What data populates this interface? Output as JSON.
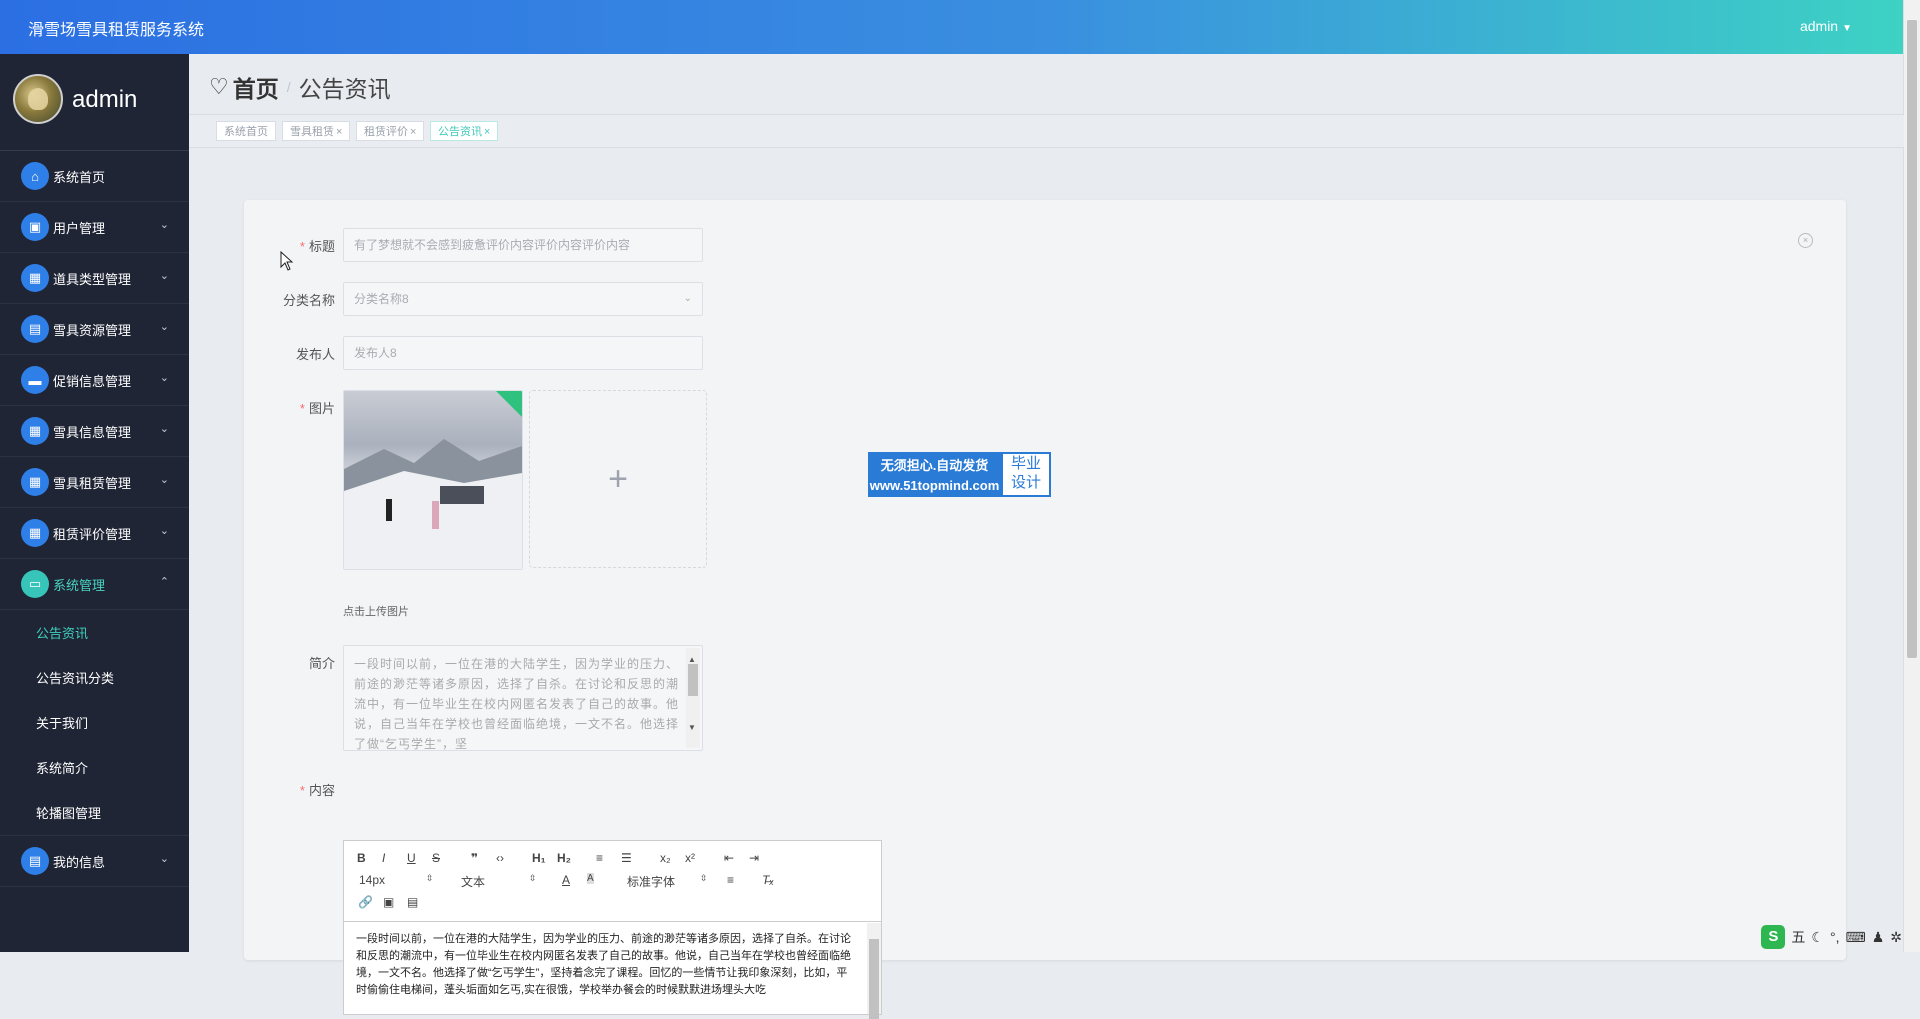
{
  "app": {
    "title": "滑雪场雪具租赁服务系统",
    "user_label": "admin",
    "user_caret": "▼"
  },
  "sidebar": {
    "profile_name": "admin",
    "items": [
      {
        "label": "系统首页",
        "icon": "home-icon",
        "glyph": "⌂"
      },
      {
        "label": "用户管理",
        "icon": "briefcase-icon",
        "glyph": "▣"
      },
      {
        "label": "道具类型管理",
        "icon": "grid-icon",
        "glyph": "▦"
      },
      {
        "label": "雪具资源管理",
        "icon": "clipboard-icon",
        "glyph": "▤"
      },
      {
        "label": "促销信息管理",
        "icon": "chat-icon",
        "glyph": "▬"
      },
      {
        "label": "雪具信息管理",
        "icon": "apps-icon",
        "glyph": "▦"
      },
      {
        "label": "雪具租赁管理",
        "icon": "grid-icon",
        "glyph": "▦"
      },
      {
        "label": "租赁评价管理",
        "icon": "grid-icon",
        "glyph": "▦"
      },
      {
        "label": "系统管理",
        "icon": "monitor-icon",
        "glyph": "▭"
      }
    ],
    "submenu": [
      "公告资讯",
      "公告资讯分类",
      "关于我们",
      "系统简介",
      "轮播图管理"
    ],
    "last_item": {
      "label": "我的信息",
      "icon": "id-card-icon",
      "glyph": "▤"
    },
    "chevron": "⌄",
    "chevron_up": "⌃"
  },
  "breadcrumb": {
    "icon": "♡",
    "home": "首页",
    "separator": "/",
    "current": "公告资讯"
  },
  "tags": [
    {
      "label": "系统首页",
      "closable": false,
      "active": false
    },
    {
      "label": "雪具租赁",
      "closable": true,
      "active": false
    },
    {
      "label": "租赁评价",
      "closable": true,
      "active": false
    },
    {
      "label": "公告资讯",
      "closable": true,
      "active": true
    }
  ],
  "tag_close": "×",
  "form": {
    "title_label": "标题",
    "title_value": "有了梦想就不会感到疲惫评价内容评价内容评价内容",
    "category_label": "分类名称",
    "category_value": "分类名称8",
    "publisher_label": "发布人",
    "publisher_value": "发布人8",
    "image_label": "图片",
    "upload_plus": "+",
    "upload_hint": "点击上传图片",
    "summary_label": "简介",
    "summary_value": "一段时间以前，一位在港的大陆学生，因为学业的压力、前途的渺茫等诸多原因，选择了自杀。在讨论和反思的潮流中，有一位毕业生在校内网匿名发表了自己的故事。他说，自己当年在学校也曾经面临绝境，一文不名。他选择了做“乞丐学生”，坚",
    "content_label": "内容",
    "required_mark": "*",
    "close_icon": "×"
  },
  "editor": {
    "buttons_row1": [
      "B",
      "I",
      "U",
      "S",
      "❞",
      "‹›",
      "H₁",
      "H₂",
      "≡",
      "☰",
      "x₂",
      "x²",
      "⇤",
      "⇥"
    ],
    "font_size": "14px",
    "block_type": "文本",
    "font_family": "标准字体",
    "content": "一段时间以前，一位在港的大陆学生，因为学业的压力、前途的渺茫等诸多原因，选择了自杀。在讨论和反思的潮流中，有一位毕业生在校内网匿名发表了自己的故事。他说，自己当年在学校也曾经面临绝境，一文不名。他选择了做“乞丐学生”，坚持着念完了课程。回忆的一些情节让我印象深刻，比如，平时偷偷住电梯间，蓬头垢面如乞丐,实在很饿，学校举办餐会的时候默默进场埋头大吃"
  },
  "promo": {
    "line1": "无须担心.自动发货",
    "line2": "www.51topmind.com",
    "badge1": "毕业",
    "badge2": "设计"
  },
  "ime": {
    "logo": "S",
    "mode": "五",
    "items": [
      "☾",
      "°,",
      "⌨",
      "♟",
      "✲"
    ]
  }
}
